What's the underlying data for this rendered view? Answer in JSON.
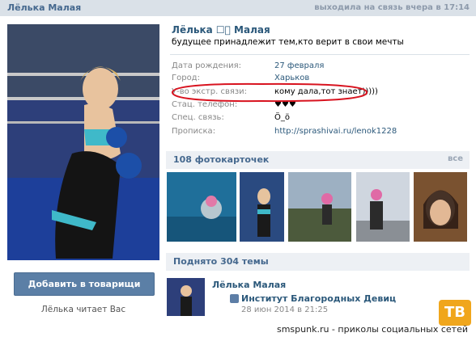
{
  "header": {
    "profile_name": "Лёлька Малая",
    "status": "выходила на связь вчера в 17:14"
  },
  "profile": {
    "name": "Лёлька ☐͙ Малая",
    "status_line": "будущее принадлежит тем,кто верит в свои мечты",
    "info": [
      {
        "label": "Дата рождения:",
        "value": "27 февраля"
      },
      {
        "label": "Город:",
        "value": "Харьков"
      },
      {
        "label": "У-во экстр. связи:",
        "value": "кому дала,тот знает)))))"
      },
      {
        "label": "Стац. телефон:",
        "value": "♥♥♥"
      },
      {
        "label": "Спец. связь:",
        "value": "Ö_ö"
      },
      {
        "label": "Прописка:",
        "value": "http://sprashivai.ru/lenok1228"
      }
    ]
  },
  "sidebar": {
    "add_button": "Добавить в товарищи",
    "reads_text": "Лёлька читает Вас"
  },
  "photos": {
    "title": "108 фотокарточек",
    "all_link": "все"
  },
  "topics": {
    "title": "Поднято 304 темы"
  },
  "post": {
    "author": "Лёлька Малая",
    "topic": "Институт Благородных Девиц",
    "date": "28 июн 2014 в 21:25"
  },
  "watermark": {
    "logo": "ТВ",
    "text": "smspunk.ru - приколы социальных сетей"
  },
  "colors": {
    "link": "#2b587a",
    "header_bg": "#dae1e8",
    "button": "#5b7fa6",
    "highlight_ink": "#d8131f"
  }
}
